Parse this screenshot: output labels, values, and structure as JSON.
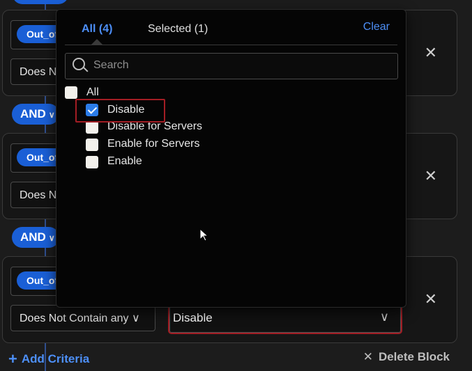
{
  "blocks": [
    {
      "field_chip": "Out_of",
      "operator_text": "Does N"
    },
    {
      "field_chip": "Out_of",
      "operator_text": "Does N"
    },
    {
      "field_chip": "Out_of",
      "operator_text": "Does Not Contain any ∨",
      "value": "Disable"
    }
  ],
  "connectors": [
    {
      "label": "AND"
    },
    {
      "label": "AND"
    }
  ],
  "footer": {
    "add_criteria": "Add Criteria",
    "delete_block": "Delete Block"
  },
  "dropdown": {
    "tabs": {
      "all": "All (4)",
      "selected": "Selected (1)"
    },
    "clear": "Clear",
    "search_placeholder": "Search",
    "all_label": "All",
    "options": [
      {
        "label": "Disable",
        "checked": true
      },
      {
        "label": "Disable for Servers",
        "checked": false
      },
      {
        "label": "Enable for Servers",
        "checked": false
      },
      {
        "label": "Enable",
        "checked": false
      }
    ]
  },
  "colors": {
    "accent": "#1a5fd6",
    "link": "#4d8ff7",
    "highlight": "#a31d24"
  }
}
